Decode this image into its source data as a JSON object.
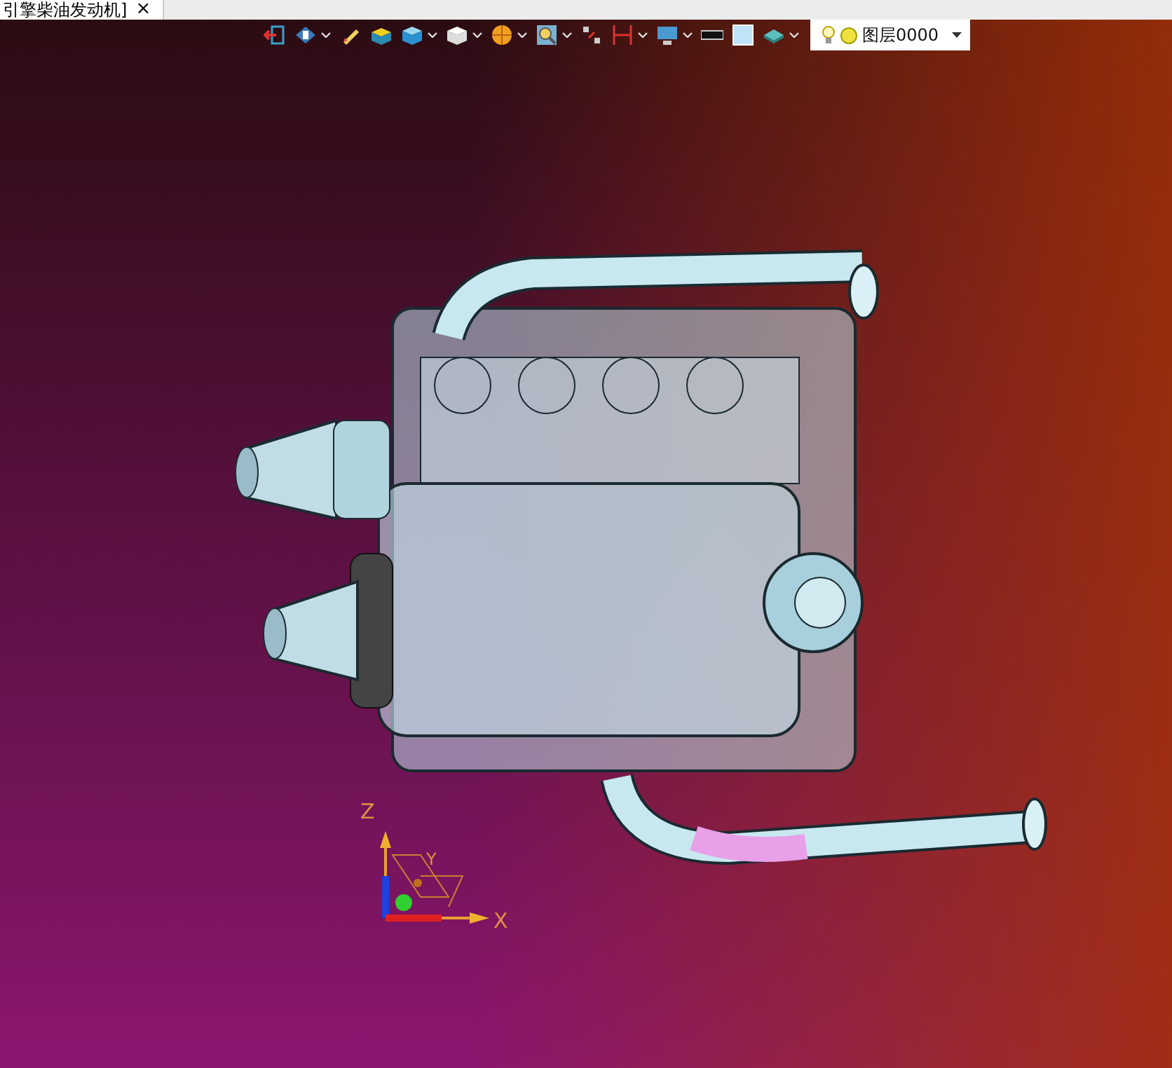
{
  "tab": {
    "title": "引擎柴油发动机]",
    "close": "×"
  },
  "toolbar": [
    {
      "kind": "exit",
      "menu": false
    },
    {
      "kind": "view",
      "menu": true
    },
    {
      "kind": "pen",
      "menu": false
    },
    {
      "kind": "cube-lid",
      "menu": false
    },
    {
      "kind": "cube-solid",
      "menu": true
    },
    {
      "kind": "cube-outline",
      "menu": true
    },
    {
      "kind": "sphere",
      "menu": true
    },
    {
      "kind": "zoom",
      "menu": true
    },
    {
      "kind": "snap",
      "menu": false
    },
    {
      "kind": "dimension",
      "menu": true
    },
    {
      "kind": "display",
      "menu": true
    },
    {
      "kind": "line",
      "menu": false
    },
    {
      "kind": "swatch",
      "menu": false
    },
    {
      "kind": "layer",
      "menu": true
    }
  ],
  "layer_combo": {
    "value": "图层0000"
  },
  "axes": {
    "x": "X",
    "y": "Y",
    "z": "Z"
  }
}
